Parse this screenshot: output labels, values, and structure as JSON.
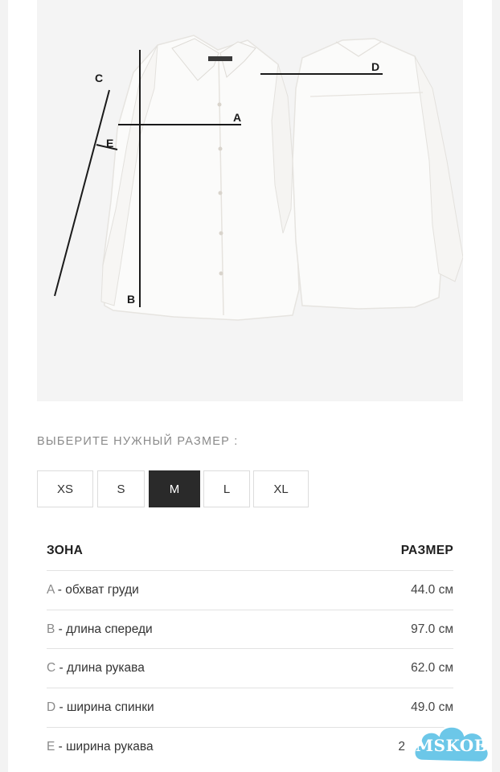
{
  "diagram": {
    "labels": {
      "a": "A",
      "b": "B",
      "c": "C",
      "d": "D",
      "e": "E"
    }
  },
  "size_prompt": "ВЫБЕРИТЕ НУЖНЫЙ РАЗМЕР :",
  "sizes": [
    "XS",
    "S",
    "M",
    "L",
    "XL"
  ],
  "selected_size": "M",
  "table": {
    "header_zone": "ЗОНА",
    "header_size": "РАЗМЕР",
    "rows": [
      {
        "letter": "A",
        "desc": " - обхват груди",
        "value": "44.0 см"
      },
      {
        "letter": "B",
        "desc": " - длина спереди",
        "value": "97.0 см"
      },
      {
        "letter": "C",
        "desc": " - длина рукава",
        "value": "62.0 см"
      },
      {
        "letter": "D",
        "desc": " - ширина спинки",
        "value": "49.0 см"
      },
      {
        "letter": "E",
        "desc": " - ширина рукава",
        "value": "2"
      }
    ]
  },
  "watermark": "MSKOB",
  "colors": {
    "selected_bg": "#2a2a2a",
    "watermark": "#6cc7e8",
    "panel_bg": "#f4f4f4"
  }
}
